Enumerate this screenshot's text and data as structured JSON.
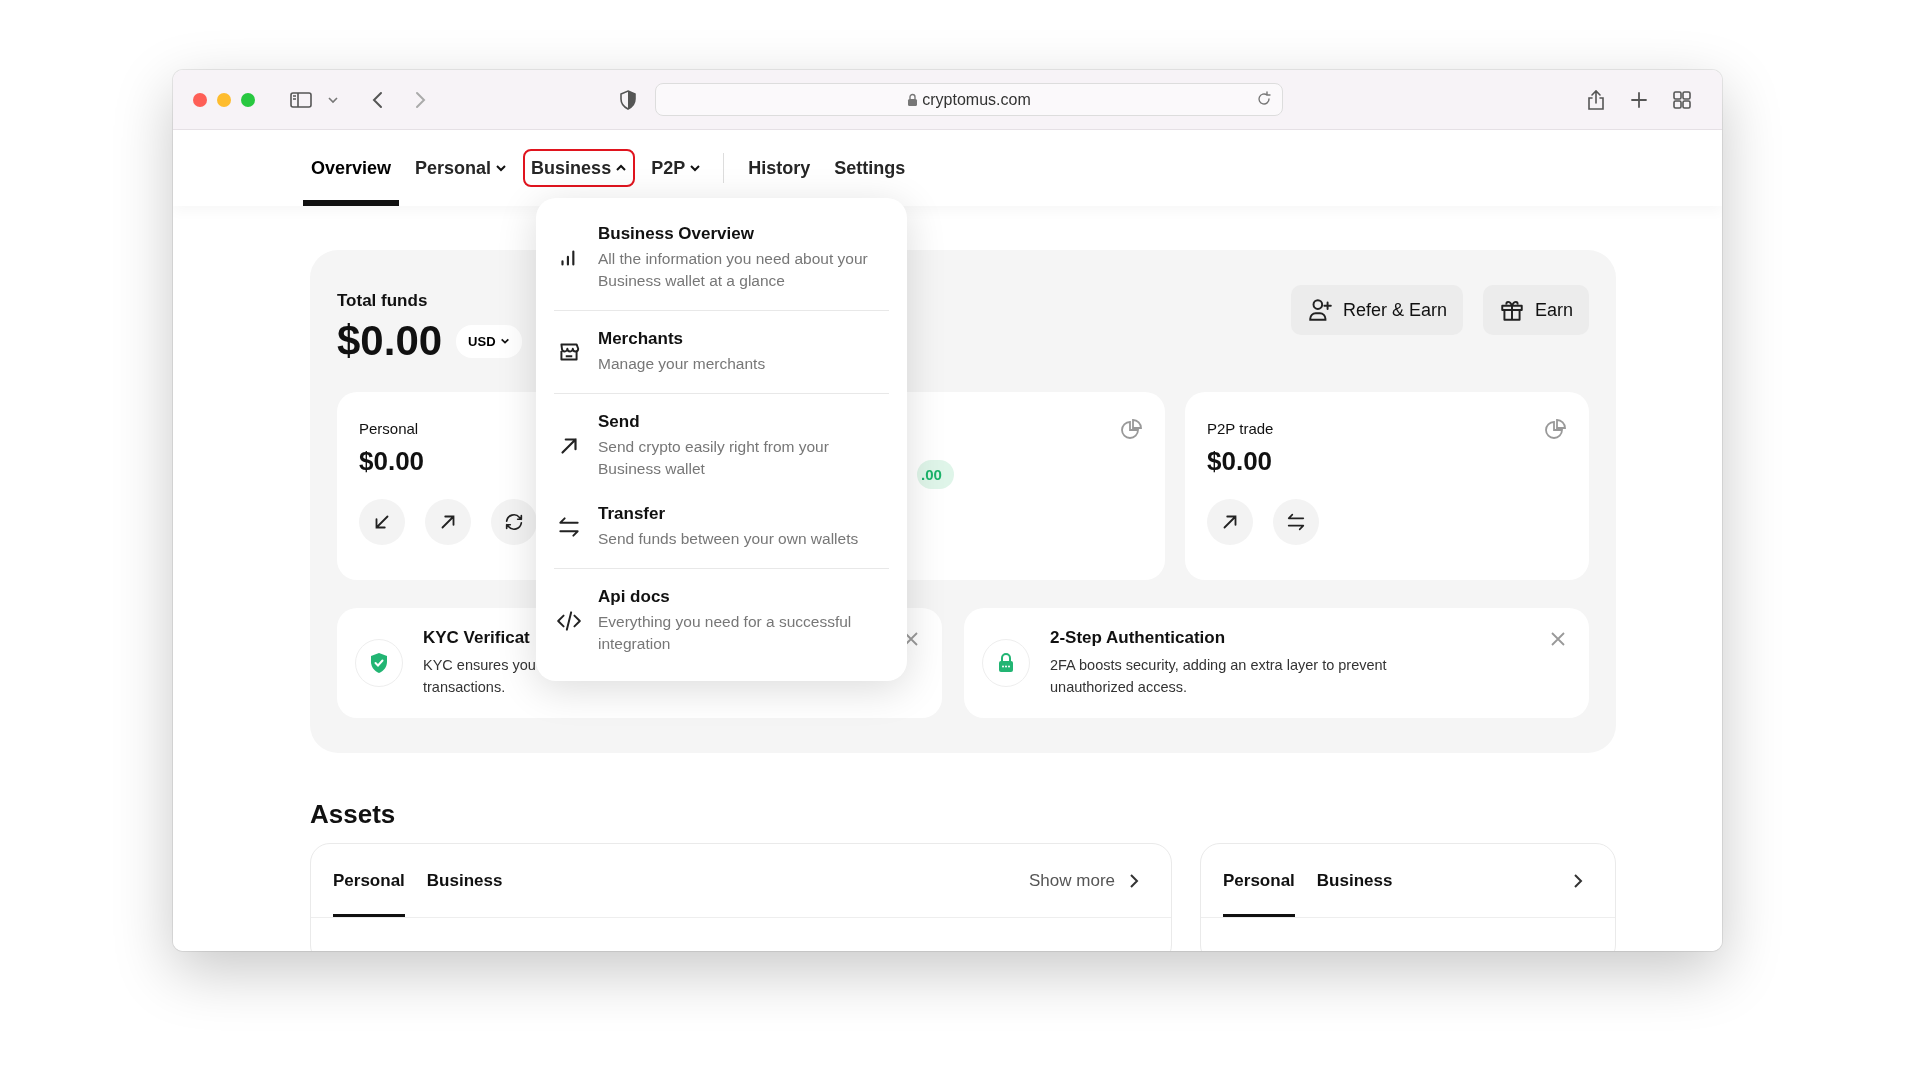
{
  "browser": {
    "url": "cryptomus.com"
  },
  "nav": {
    "primary": [
      {
        "label": "Overview",
        "kind": "link",
        "selected": true
      },
      {
        "label": "Personal",
        "kind": "dropdown",
        "selected": false,
        "expanded": false
      },
      {
        "label": "Business",
        "kind": "dropdown",
        "selected": false,
        "expanded": true
      },
      {
        "label": "P2P",
        "kind": "dropdown",
        "selected": false,
        "expanded": false
      }
    ],
    "secondary": [
      {
        "label": "History",
        "kind": "link",
        "selected": false
      },
      {
        "label": "Settings",
        "kind": "link",
        "selected": false
      }
    ]
  },
  "dropdown": [
    {
      "title": "Business Overview",
      "description": "All the information you need about your Business wallet at a glance",
      "kind": "bars",
      "separated": false
    },
    {
      "title": "Merchants",
      "description": "Manage your merchants",
      "kind": "store",
      "separated": true
    },
    {
      "title": "Send",
      "description": "Send crypto easily right from your Business wallet",
      "kind": "send",
      "separated": true
    },
    {
      "title": "Transfer",
      "description": "Send funds between your own wallets",
      "kind": "transfer",
      "separated": false
    },
    {
      "title": "Api docs",
      "description": "Everything you need for a successful integration",
      "kind": "code",
      "separated": true
    }
  ],
  "funds": {
    "title": "Total funds",
    "amount": "$0.00",
    "currency": "USD"
  },
  "actions": [
    {
      "label": "Refer & Earn",
      "kind": "user-plus"
    },
    {
      "label": "Earn",
      "kind": "gift"
    }
  ],
  "wallets": [
    {
      "label": "Personal",
      "amount": "$0.00",
      "actions": [
        {
          "kind": "receive"
        },
        {
          "kind": "send"
        },
        {
          "kind": "exchange"
        }
      ]
    },
    {
      "badge": ".00",
      "stats_icon": true
    },
    {
      "label": "P2P trade",
      "amount": "$0.00",
      "stats_icon": true,
      "actions": [
        {
          "kind": "send"
        },
        {
          "kind": "transfer"
        }
      ]
    }
  ],
  "notices": [
    {
      "title": "KYC Verificat",
      "lines": [
        "KYC ensures you",
        "transactions."
      ],
      "kind": "shield",
      "closable": true
    },
    {
      "title": "2-Step Authentication",
      "lines": [
        "2FA boosts security, adding an extra layer to prevent",
        "unauthorized access."
      ],
      "kind": "lock",
      "closable": true
    }
  ],
  "assets": {
    "title": "Assets",
    "panels": [
      {
        "tabs": [
          {
            "label": "Personal",
            "selected": true
          },
          {
            "label": "Business",
            "selected": false
          }
        ],
        "more": "Show more"
      },
      {
        "tabs": [
          {
            "label": "Personal",
            "selected": true
          },
          {
            "label": "Business",
            "selected": false
          }
        ]
      }
    ]
  }
}
